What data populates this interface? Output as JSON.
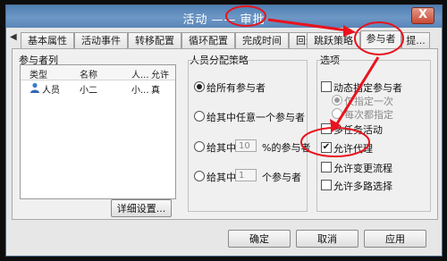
{
  "window": {
    "title_left": "活动",
    "title_sep": "——",
    "title_right": "审批",
    "close_label": "X"
  },
  "tabs": {
    "scroll_left": "◀",
    "items": [
      {
        "label": "基本属性"
      },
      {
        "label": "活动事件"
      },
      {
        "label": "转移配置"
      },
      {
        "label": "循环配置"
      },
      {
        "label": "完成时间"
      },
      {
        "label": "回退设置"
      },
      {
        "label": "跳跃策略"
      },
      {
        "label": "参与者"
      },
      {
        "label": "提..."
      }
    ],
    "active_index": 7
  },
  "participants": {
    "title": "参与者列",
    "columns": [
      "类型",
      "名称",
      "人...",
      "允许"
    ],
    "rows": [
      {
        "type": "人员",
        "name": "小二",
        "person": "小...",
        "allow": "真"
      }
    ],
    "detail_button": "详细设置..."
  },
  "strategy": {
    "title": "人员分配策略",
    "options": [
      {
        "label": "给所有参与者",
        "checked": true
      },
      {
        "label": "给其中任意一个参与者",
        "checked": false
      },
      {
        "label_before": "给其中",
        "value": "10",
        "label_after": "%的参与者",
        "checked": false
      },
      {
        "label_before": "给其中",
        "value": "1",
        "label_after": "个参与者",
        "checked": false
      }
    ]
  },
  "options": {
    "title": "选项",
    "dynamic_participant": {
      "label": "动态指定参与者",
      "checked": false
    },
    "sub_once": {
      "label": "仅指定一次",
      "checked": true
    },
    "sub_each": {
      "label": "每次都指定",
      "checked": false
    },
    "multi_task": {
      "label": "多任务活动",
      "checked": false
    },
    "allow_delegate": {
      "label": "允许代理",
      "checked": true
    },
    "allow_change_flow": {
      "label": "允许变更流程",
      "checked": false
    },
    "allow_multi_route": {
      "label": "允许多路选择",
      "checked": false
    }
  },
  "footer": {
    "ok": "确定",
    "cancel": "取消",
    "apply": "应用"
  },
  "colors": {
    "annotation": "#e8131d",
    "title_bar": "#5f8bbd"
  }
}
